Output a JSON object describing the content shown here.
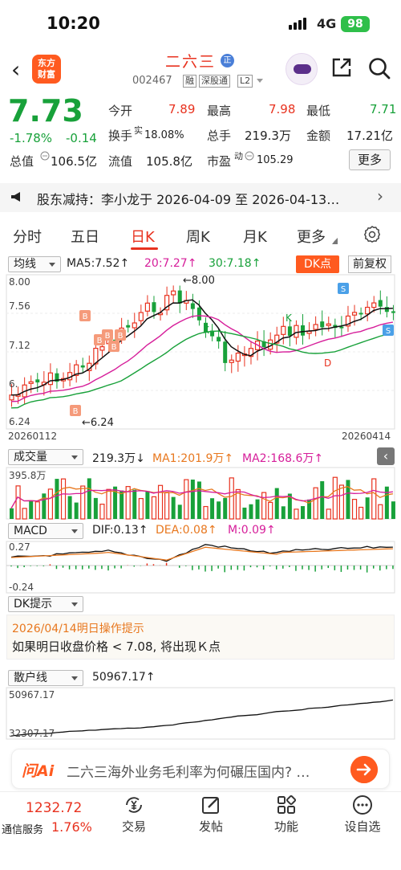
{
  "status_bar": {
    "time": "10:20",
    "network": "4G",
    "battery": "98"
  },
  "header": {
    "logo_text": "东方财富",
    "stock_name": "二六三",
    "badge": "正",
    "stock_code": "002467",
    "tags": [
      "融",
      "深股通",
      "L2"
    ]
  },
  "quote": {
    "price": "7.73",
    "change_pct": "-1.78%",
    "change_amt": "-0.14",
    "fields": {
      "open_label": "今开",
      "open": "7.89",
      "high_label": "最高",
      "high": "7.98",
      "low_label": "最低",
      "low": "7.71",
      "turnover_label": "换手",
      "turnover_sup": "实",
      "turnover": "18.08%",
      "volume_label": "总手",
      "volume": "219.3万",
      "amount_label": "金额",
      "amount": "17.21亿",
      "mcap_label": "总值",
      "mcap": "106.5亿",
      "float_label": "流值",
      "float_mcap": "105.8亿",
      "pe_label": "市盈",
      "pe_sup": "动",
      "pe": "105.29"
    },
    "more_button": "更多"
  },
  "notice": {
    "text": "股东减持：李小龙于 2026-04-09 至 2026-04-13…"
  },
  "tabs": {
    "items": [
      "分时",
      "五日",
      "日K",
      "周K",
      "月K",
      "更多"
    ],
    "active": "日K"
  },
  "kline": {
    "selector": "均线",
    "ma5": "MA5:7.52↑",
    "ma20": "20:7.27↑",
    "ma30": "30:7.18↑",
    "dk_button": "DK点",
    "fq_button": "前复权",
    "y_top": "8.00",
    "y_mid": "7.56",
    "y_low": "7.12",
    "y_bottom": "6.24",
    "y_clip": "6.",
    "max_label": "8.00",
    "min_label": "6.24",
    "date_start": "20260112",
    "date_end": "20260414",
    "markers": {
      "b": "B",
      "s": "S",
      "t": "T",
      "k": "K",
      "d": "D"
    }
  },
  "volume": {
    "selector": "成交量",
    "vol": "219.3万↓",
    "ma1": "MA1:201.9万↑",
    "ma2": "MA2:168.6万↑",
    "y_top": "395.8万"
  },
  "macd": {
    "selector": "MACD",
    "dif": "DIF:0.13↑",
    "dea": "DEA:0.08↑",
    "m": "M:0.09↑",
    "y_top": "0.27",
    "y_bottom": "-0.24"
  },
  "dk_tip": {
    "selector": "DK提示",
    "title": "2026/04/14明日操作提示",
    "text": "如果明日收盘价格 < 7.08, 将出现Ｋ点"
  },
  "retail_line": {
    "selector": "散户线",
    "value": "50967.17↑",
    "y_top": "50967.17",
    "y_bottom": "32307.17"
  },
  "ai_bar": {
    "logo": "问Ai",
    "question": "二六三海外业务毛利率为何碾压国内? …"
  },
  "bottom_nav": {
    "index_value": "1232.72",
    "index_name": "通信服务",
    "index_pct": "1.76%",
    "items": [
      "交易",
      "发帖",
      "功能",
      "设自选"
    ]
  },
  "colors": {
    "up": "#e8321f",
    "down": "#18a13a",
    "accent": "#ff5a1f"
  }
}
